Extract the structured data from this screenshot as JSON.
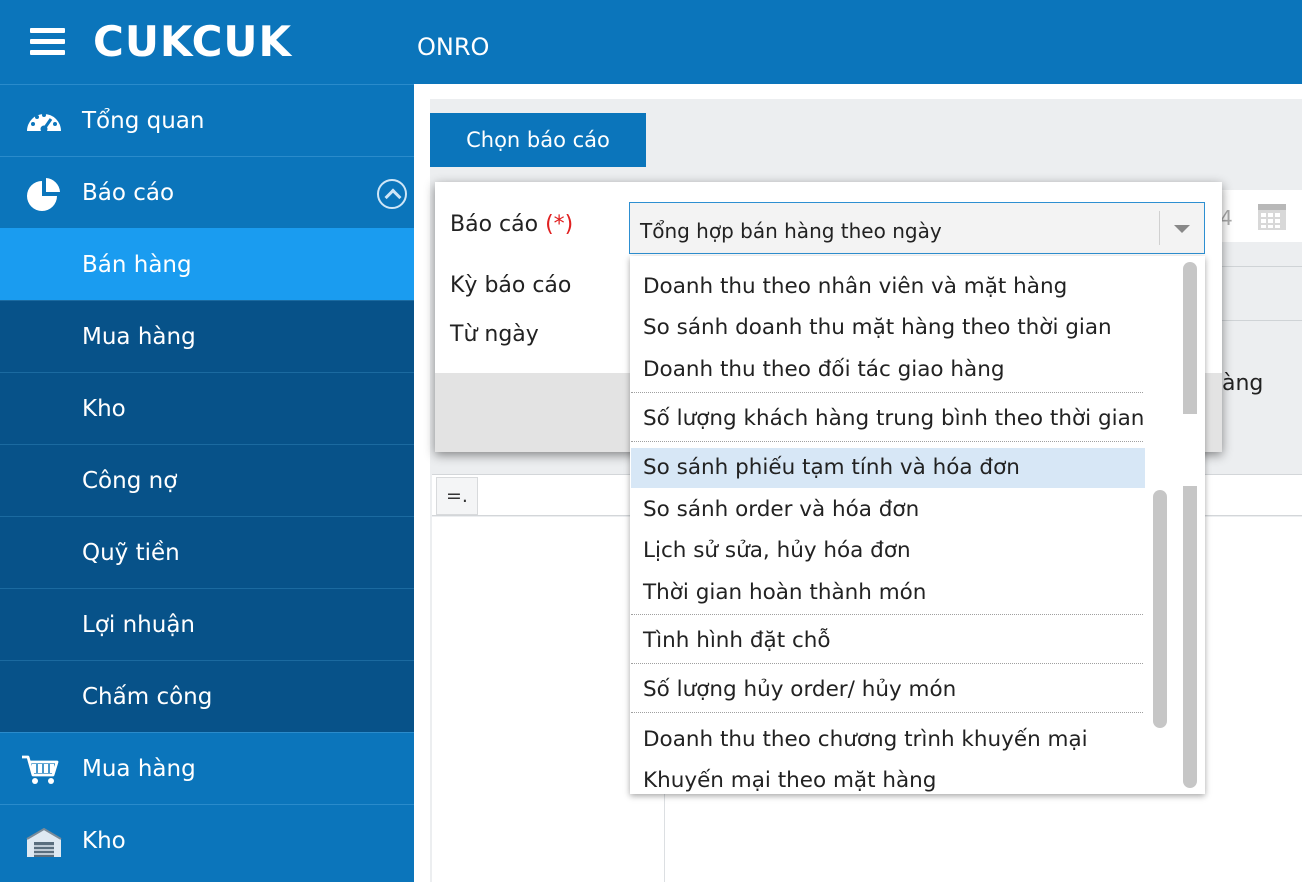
{
  "header": {
    "logo": "CUKCUK",
    "store_name": "ONRO"
  },
  "sidebar": {
    "items": [
      {
        "label": "Tổng quan",
        "icon": "dashboard-icon"
      },
      {
        "label": "Báo cáo",
        "icon": "pie-chart-icon",
        "expanded": true
      },
      {
        "label": "Bán hàng",
        "active": true
      },
      {
        "label": "Mua hàng"
      },
      {
        "label": "Kho"
      },
      {
        "label": "Công nợ"
      },
      {
        "label": "Quỹ tiền"
      },
      {
        "label": "Lợi nhuận"
      },
      {
        "label": "Chấm công"
      },
      {
        "label": "Mua hàng",
        "icon": "cart-icon"
      },
      {
        "label": "Kho",
        "icon": "warehouse-icon"
      }
    ]
  },
  "main": {
    "choose_report_button": "Chọn báo cáo",
    "date_tail": "4",
    "bg_label": "àng",
    "filter_operator": "=."
  },
  "dialog": {
    "report_label": "Báo cáo",
    "required_mark": "(*)",
    "period_label": "Kỳ báo cáo",
    "from_date_label": "Từ ngày",
    "report_select": {
      "value": "Tổng hợp bán hàng theo ngày",
      "options": [
        "Doanh thu theo nhân viên và mặt hàng",
        "So sánh doanh thu mặt hàng theo thời gian",
        "Doanh thu theo đối tác giao hàng",
        "Số lượng khách hàng trung bình theo thời gian",
        "So sánh phiếu tạm tính và hóa đơn",
        "So sánh order và hóa đơn",
        "Lịch sử sửa, hủy hóa đơn",
        "Thời gian hoàn thành món",
        "Tình hình đặt chỗ",
        "Số lượng hủy order/ hủy món",
        "Doanh thu theo chương trình khuyến mại",
        "Khuyến mại theo mặt hàng"
      ],
      "highlighted": "So sánh phiếu tạm tính và hóa đơn"
    }
  },
  "colors": {
    "brand": "#0b75bb",
    "active": "#1a9cf0",
    "submenu": "#075289",
    "required": "#e02020",
    "highlight": "#d7e7f6"
  }
}
